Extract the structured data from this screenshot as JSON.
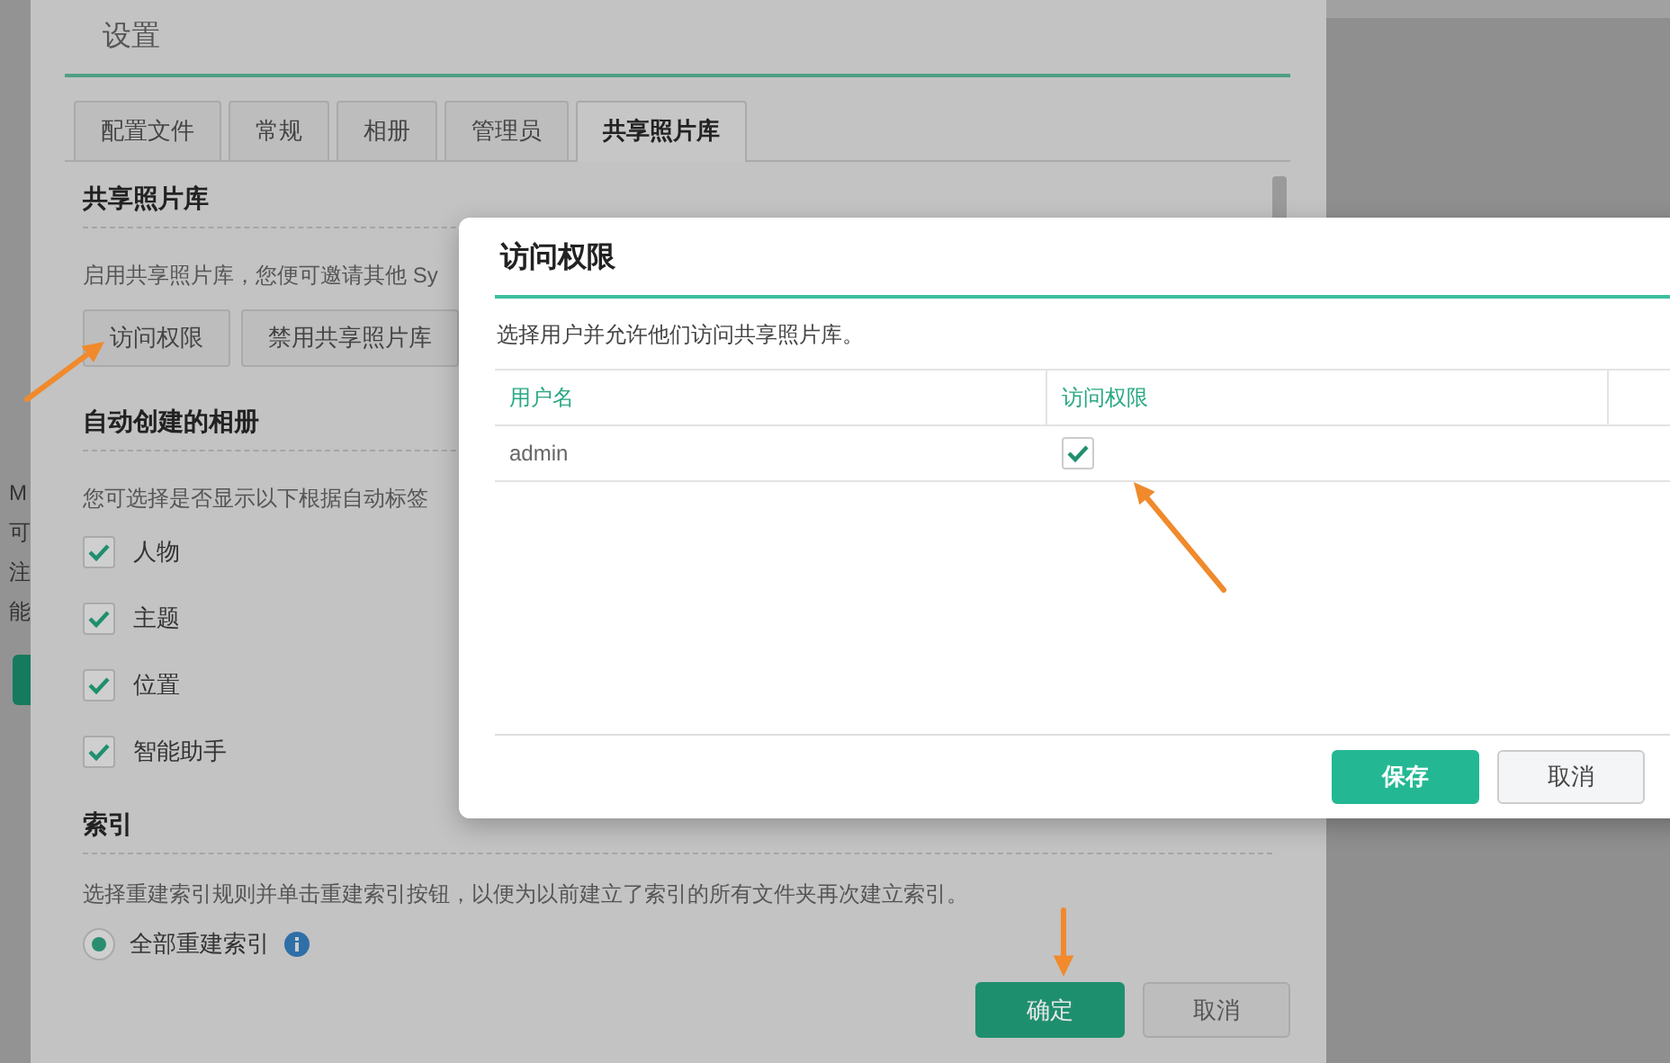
{
  "background_fragments": [
    "M",
    "可",
    "注",
    "能"
  ],
  "settings": {
    "title": "设置",
    "tabs": [
      {
        "label": "配置文件",
        "selected": false
      },
      {
        "label": "常规",
        "selected": false
      },
      {
        "label": "相册",
        "selected": false
      },
      {
        "label": "管理员",
        "selected": false
      },
      {
        "label": "共享照片库",
        "selected": true
      }
    ],
    "shared_library": {
      "heading": "共享照片库",
      "description": "启用共享照片库，您便可邀请其他 Sy",
      "buttons": [
        "访问权限",
        "禁用共享照片库"
      ]
    },
    "auto_albums": {
      "heading": "自动创建的相册",
      "description": "您可选择是否显示以下根据自动标签",
      "options": [
        {
          "label": "人物",
          "checked": true
        },
        {
          "label": "主题",
          "checked": true
        },
        {
          "label": "位置",
          "checked": true
        },
        {
          "label": "智能助手",
          "checked": true
        }
      ]
    },
    "index": {
      "heading": "索引",
      "description": "选择重建索引规则并单击重建索引按钮，以便为以前建立了索引的所有文件夹再次建立索引。",
      "options": [
        {
          "label": "全部重建索引",
          "selected": true
        }
      ]
    },
    "buttons": [
      {
        "label": "确定",
        "kind": "primary"
      },
      {
        "label": "取消",
        "kind": "secondary"
      }
    ]
  },
  "access_dialog": {
    "title": "访问权限",
    "description": "选择用户并允许他们访问共享照片库。",
    "columns": [
      "用户名",
      "访问权限"
    ],
    "rows": [
      {
        "username": "admin",
        "access": true
      }
    ],
    "buttons": [
      {
        "label": "保存",
        "kind": "primary"
      },
      {
        "label": "取消",
        "kind": "secondary"
      }
    ]
  }
}
